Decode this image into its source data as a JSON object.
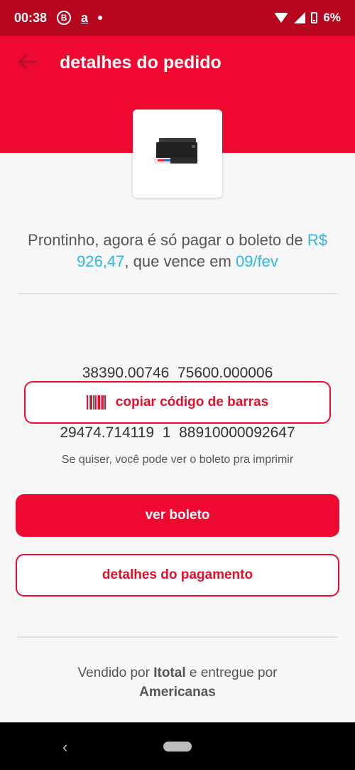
{
  "status_bar": {
    "time": "00:38",
    "icon_b": "B",
    "icon_a": "a",
    "battery": "6%"
  },
  "header": {
    "title": "detalhes do pedido"
  },
  "product": {
    "image": "printer"
  },
  "payment_message": {
    "prefix": "Prontinho, agora é só pagar o boleto de ",
    "amount": "R$ 926,47",
    "middle": ", que vence em ",
    "due_date": "09/fev"
  },
  "barcode": {
    "line1": "38390.00746  75600.000006",
    "line2": "29474.714119  1  88910000092647"
  },
  "buttons": {
    "copy_barcode": "copiar código de barras",
    "view_boleto": "ver boleto",
    "payment_details": "detalhes do pagamento"
  },
  "hint": "Se quiser, você pode ver o boleto pra imprimir",
  "seller": {
    "prefix": "Vendido por ",
    "seller_name": "Itotal",
    "middle": " e entregue por ",
    "carrier": "Americanas"
  },
  "colors": {
    "primary": "#ef0830",
    "status_bar": "#b5061d",
    "highlight": "#2db7e3"
  }
}
